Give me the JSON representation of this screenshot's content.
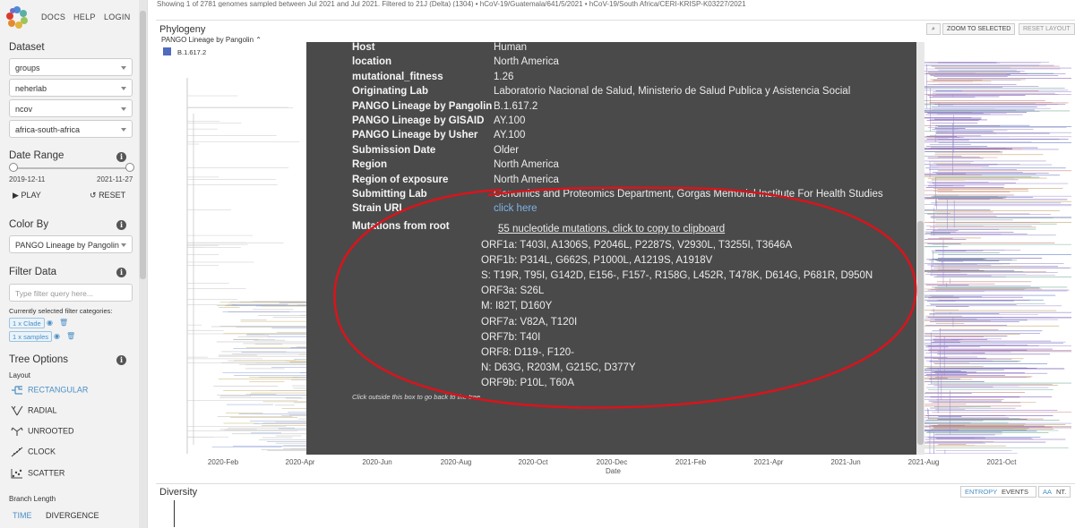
{
  "header": {
    "truncated_text": "Showing 1 of 2781 genomes sampled between Jul 2021 and Jul 2021. Filtered to 21J (Delta) (1304) • hCoV-19/Guatemala/641/5/2021 • hCoV-19/South Africa/CERI-KRISP-K03227/2021"
  },
  "nav": {
    "docs": "DOCS",
    "help": "HELP",
    "login": "LOGIN"
  },
  "sidebar": {
    "dataset_title": "Dataset",
    "dataset_selects": [
      "groups",
      "neherlab",
      "ncov",
      "africa-south-africa"
    ],
    "date_range_title": "Date Range",
    "date_start": "2019-12-11",
    "date_end": "2021-11-27",
    "play_label": "PLAY",
    "reset_label": "RESET",
    "color_by_title": "Color By",
    "color_by_value": "PANGO Lineage by Pangolin",
    "filter_title": "Filter Data",
    "filter_placeholder": "Type filter query here...",
    "selected_filters_label": "Currently selected filter categories:",
    "filter_chips": [
      "1 x Clade",
      "1 x samples"
    ],
    "tree_options_title": "Tree Options",
    "layout_label": "Layout",
    "layouts": [
      "RECTANGULAR",
      "RADIAL",
      "UNROOTED",
      "CLOCK",
      "SCATTER"
    ],
    "branch_length_label": "Branch Length",
    "branch_time": "TIME",
    "branch_divergence": "DIVERGENCE"
  },
  "phylogeny": {
    "title": "Phylogeny",
    "legend_title": "PANGO Lineage by Pangolin",
    "legend_item": "B.1.617.2",
    "legend_color": "#4f6bbf",
    "zoom_button": "ZOOM TO SELECTED",
    "reset_button": "RESET LAYOUT",
    "axis_ticks": [
      "2020-Feb",
      "2020-Apr",
      "2020-Jun",
      "2020-Aug",
      "2020-Oct",
      "2020-Dec",
      "2021-Feb",
      "2021-Apr",
      "2021-Jun",
      "2021-Aug",
      "2021-Oct"
    ],
    "axis_title": "Date"
  },
  "modal": {
    "rows": [
      {
        "key": "Host",
        "value": "Human"
      },
      {
        "key": "location",
        "value": "North America"
      },
      {
        "key": "mutational_fitness",
        "value": "1.26"
      },
      {
        "key": "Originating Lab",
        "value": "Laboratorio Nacional de Salud, Ministerio de Salud Publica y Asistencia Social"
      },
      {
        "key": "PANGO Lineage by Pangolin",
        "value": "B.1.617.2"
      },
      {
        "key": "PANGO Lineage by GISAID",
        "value": "AY.100"
      },
      {
        "key": "PANGO Lineage by Usher",
        "value": "AY.100"
      },
      {
        "key": "Submission Date",
        "value": "Older"
      },
      {
        "key": "Region",
        "value": "North America"
      },
      {
        "key": "Region of exposure",
        "value": "North America"
      },
      {
        "key": "Submitting Lab",
        "value": "Genomics and Proteomics Department, Gorgas Memorial Institute For Health Studies"
      },
      {
        "key": "Strain URL",
        "value": "click here"
      }
    ],
    "mutations_key": "Mutations from root",
    "mutations_link": "55 nucleotide mutations, click to copy to clipboard",
    "mutations": [
      "ORF1a: T403I, A1306S, P2046L, P2287S, V2930L, T3255I, T3646A",
      "ORF1b: P314L, G662S, P1000L, A1219S, A1918V",
      "S: T19R, T95I, G142D, E156-, F157-, R158G, L452R, T478K, D614G, P681R, D950N",
      "ORF3a: S26L",
      "M: I82T, D160Y",
      "ORF7a: V82A, T120I",
      "ORF7b: T40I",
      "ORF8: D119-, F120-",
      "N: D63G, R203M, G215C, D377Y",
      "ORF9b: P10L, T60A"
    ],
    "close_hint": "Click outside this box to go back to the tree"
  },
  "diversity": {
    "title": "Diversity",
    "entropy": "ENTROPY",
    "events": "EVENTS",
    "aa": "AA",
    "nt": "NT."
  },
  "annotation": {
    "ellipse_color": "#d9141b"
  }
}
